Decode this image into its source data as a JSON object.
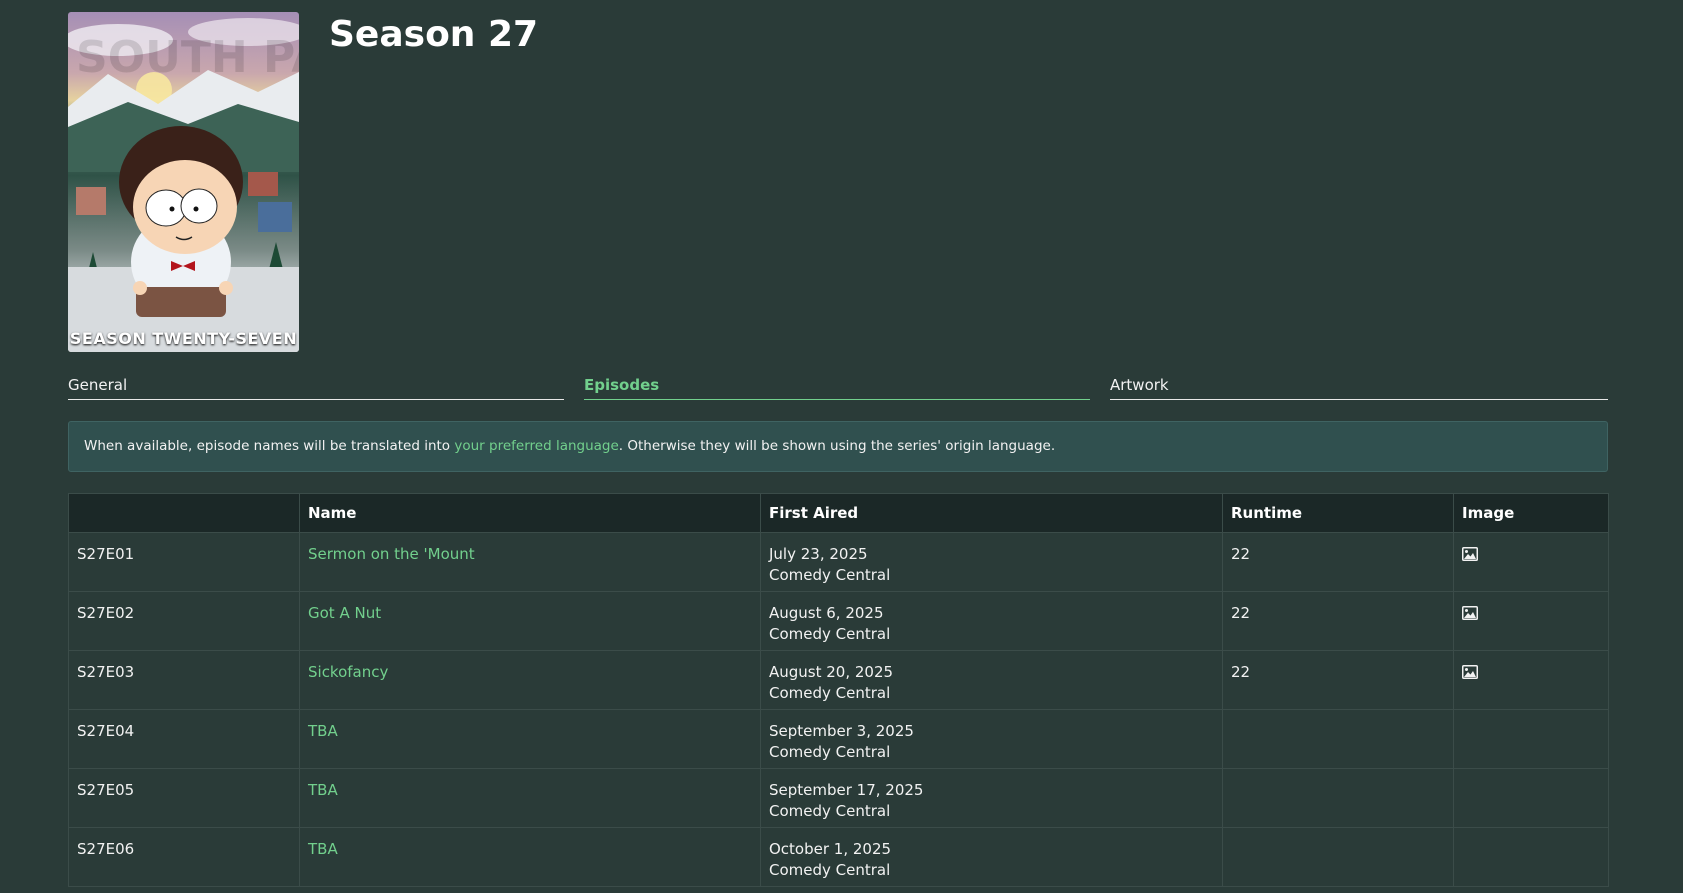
{
  "season": {
    "title": "Season 27",
    "poster_caption": "SEASON TWENTY-SEVEN",
    "poster_logo": "SOUTH PARK"
  },
  "tabs": [
    {
      "label": "General",
      "active": false
    },
    {
      "label": "Episodes",
      "active": true
    },
    {
      "label": "Artwork",
      "active": false
    }
  ],
  "notice": {
    "before": "When available, episode names will be translated into ",
    "link": "your preferred language",
    "after": ". Otherwise they will be shown using the series' origin language."
  },
  "table": {
    "headers": [
      "",
      "Name",
      "First Aired",
      "Runtime",
      "Image"
    ],
    "rows": [
      {
        "code": "S27E01",
        "name": "Sermon on the 'Mount",
        "date": "July 23, 2025",
        "network": "Comedy Central",
        "runtime": "22",
        "has_image": true
      },
      {
        "code": "S27E02",
        "name": "Got A Nut",
        "date": "August 6, 2025",
        "network": "Comedy Central",
        "runtime": "22",
        "has_image": true
      },
      {
        "code": "S27E03",
        "name": "Sickofancy",
        "date": "August 20, 2025",
        "network": "Comedy Central",
        "runtime": "22",
        "has_image": true
      },
      {
        "code": "S27E04",
        "name": "TBA",
        "date": "September 3, 2025",
        "network": "Comedy Central",
        "runtime": "",
        "has_image": false
      },
      {
        "code": "S27E05",
        "name": "TBA",
        "date": "September 17, 2025",
        "network": "Comedy Central",
        "runtime": "",
        "has_image": false
      },
      {
        "code": "S27E06",
        "name": "TBA",
        "date": "October 1, 2025",
        "network": "Comedy Central",
        "runtime": "",
        "has_image": false
      }
    ]
  },
  "icons": {
    "image_cell": "image-icon"
  },
  "colors": {
    "accent": "#72d08d",
    "background": "#2a3b38",
    "header_bg": "#1b2827",
    "notice_bg": "#30504f"
  }
}
